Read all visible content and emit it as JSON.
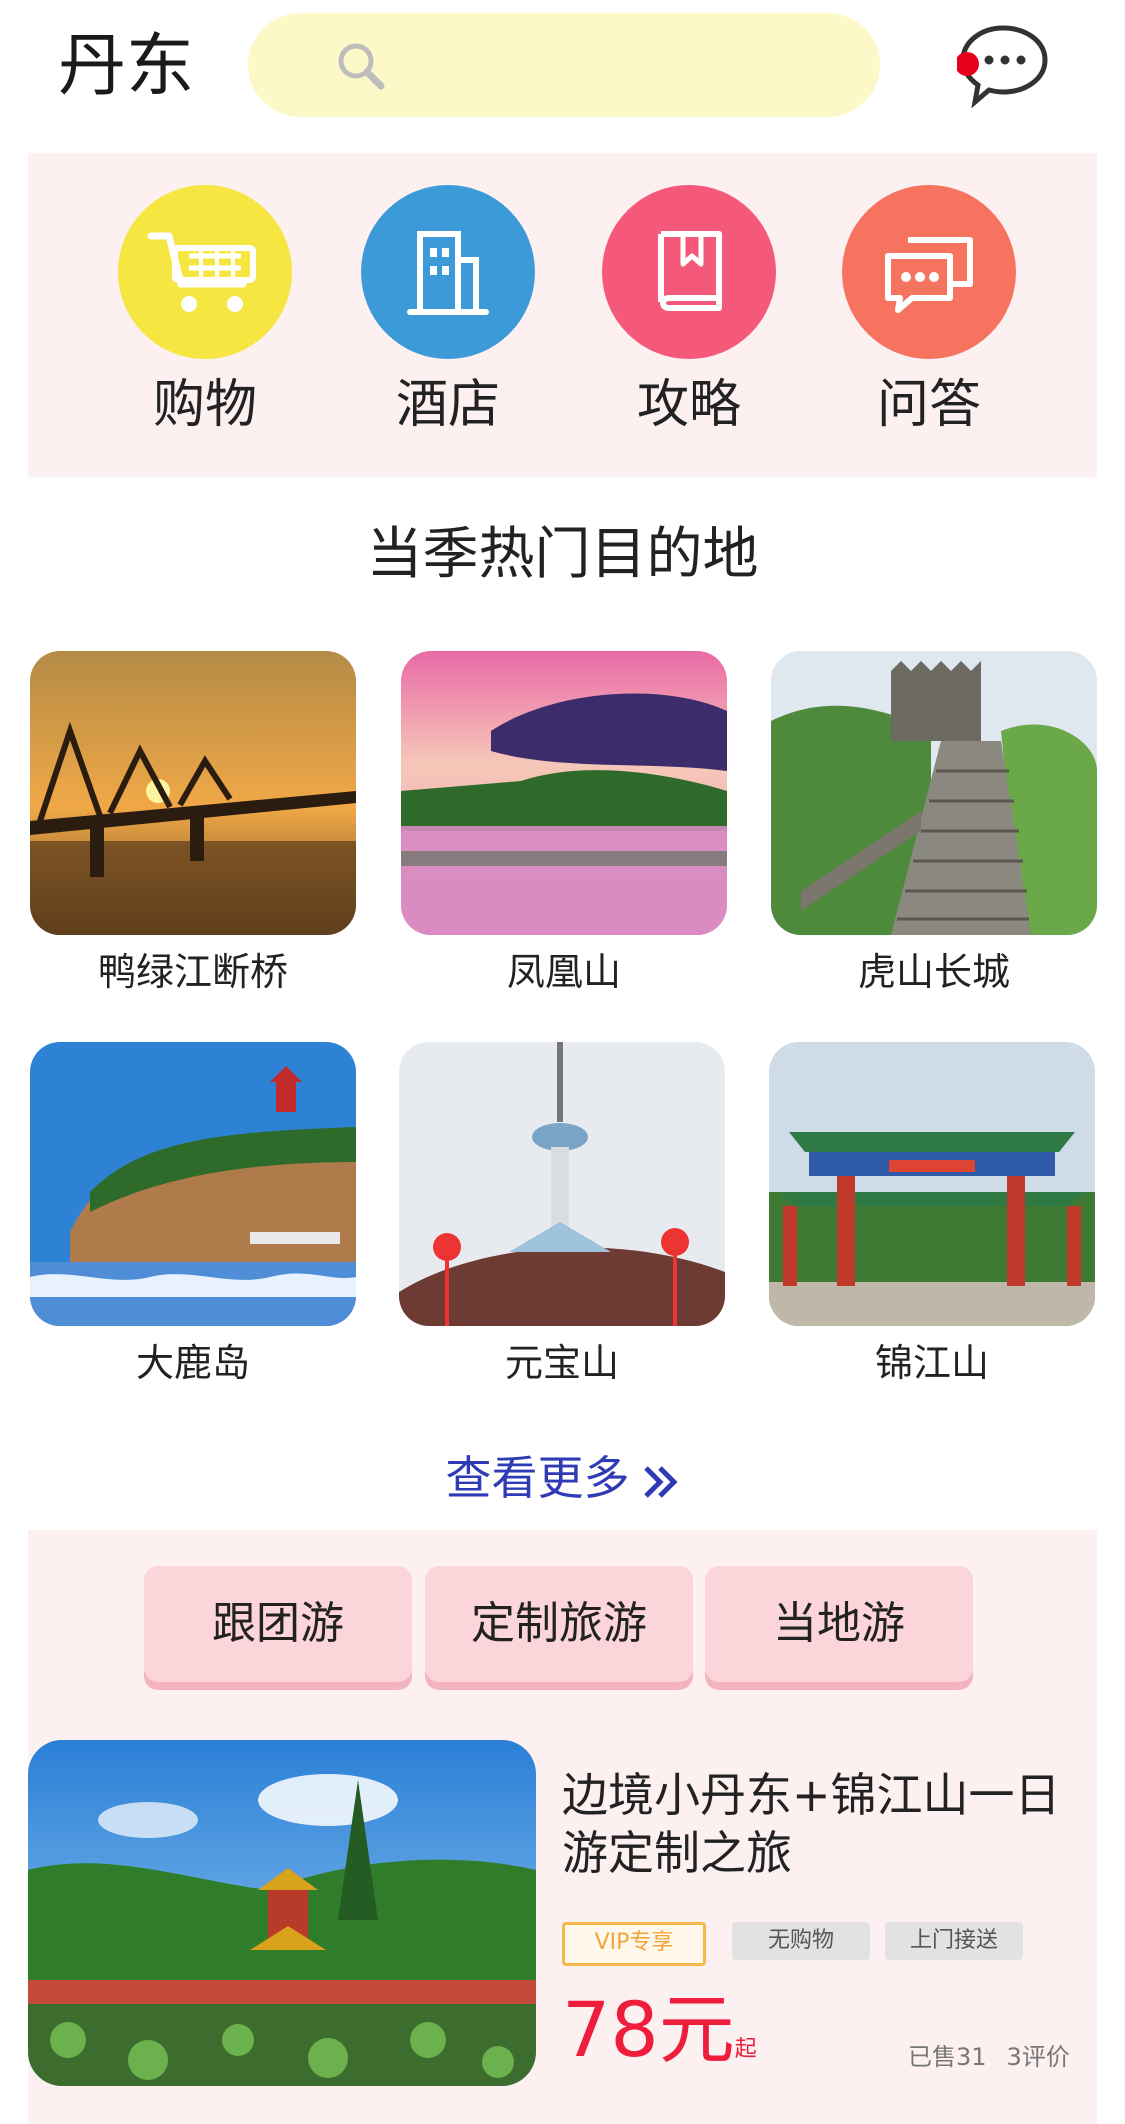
{
  "header": {
    "city": "丹东",
    "search_icon": "search-icon",
    "message_icon": "chat-bubble-icon"
  },
  "categories": [
    {
      "label": "购物",
      "icon": "shopping-cart-icon",
      "color": "#f5e642"
    },
    {
      "label": "酒店",
      "icon": "hotel-building-icon",
      "color": "#3d9ad8"
    },
    {
      "label": "攻略",
      "icon": "guide-book-icon",
      "color": "#f4597a"
    },
    {
      "label": "问答",
      "icon": "qa-chat-icon",
      "color": "#f6735f"
    }
  ],
  "section_title": "当季热门目的地",
  "destinations": [
    {
      "name": "鸭绿江断桥"
    },
    {
      "name": "凤凰山"
    },
    {
      "name": "虎山长城"
    },
    {
      "name": "大鹿岛"
    },
    {
      "name": "元宝山"
    },
    {
      "name": "锦江山"
    }
  ],
  "more_label": "查看更多",
  "tour_tabs": [
    "跟团游",
    "定制旅游",
    "当地游"
  ],
  "tour_card": {
    "title": "边境小丹东+锦江山一日游定制之旅",
    "tags": [
      "VIP专享",
      "无购物",
      "上门接送"
    ],
    "price": "78元",
    "price_suffix": "起",
    "sold": "已售31",
    "reviews": "3评价"
  },
  "colors": {
    "accent_blue": "#2f3bb4",
    "price_red": "#ee1d3c",
    "section_bg": "#fdf0f1",
    "search_bg": "#fcf8c8"
  }
}
